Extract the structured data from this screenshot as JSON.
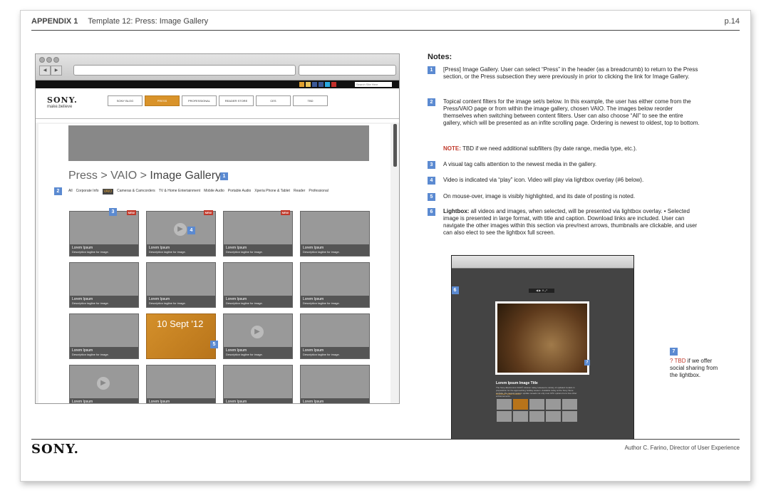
{
  "header": {
    "appendix": "APPENDIX 1",
    "template": "Template 12: Press: Image Gallery",
    "page": "p.14"
  },
  "footer": {
    "logo": "SONY.",
    "author": "Author C. Farino, Director of User Experience"
  },
  "site": {
    "logo": "SONY.",
    "tagline": "make.believe",
    "nav": [
      "SONY BLOG",
      "PRESS",
      "PROFESSIONAL",
      "READER STORE",
      "CES",
      "TBD"
    ],
    "nav_active": "PRESS",
    "search_placeholder": "Search Site Here"
  },
  "gallery": {
    "breadcrumb": {
      "p1": "Press",
      "sep1": " > ",
      "p2": "VAIO",
      "sep2": " > ",
      "p3": "Image Gallery"
    },
    "filters": [
      "All",
      "Corporate Info",
      "VAIO",
      "Cameras & Camcorders",
      "TV & Home Entertainment",
      "Mobile Audio",
      "Portable Audio",
      "Xperia Phone & Tablet",
      "Reader",
      "Professional"
    ],
    "filter_active": "VAIO",
    "tile_title": "Lorem Ipsum",
    "tile_desc": "Description tagline for image.",
    "new_badge": "NEW",
    "highlight_date": "10 Sept '12"
  },
  "annotations": {
    "n1": "1",
    "n2": "2",
    "n3": "3",
    "n4": "4",
    "n5": "5",
    "n6": "6",
    "n7": "7"
  },
  "notes": {
    "title": "Notes:",
    "items": [
      {
        "num": "1",
        "text": "[Press] Image Gallery. User can select “Press” in the header (as a breadcrumb) to return to the Press section, or the Press subsection they were previously in prior to clicking the link for Image Gallery."
      },
      {
        "num": "2",
        "text": "Topical content filters for the image set/s below. In this example, the user has either come from the Press/VAIO page or from within the image gallery, chosen VAIO. The images below reorder themselves when switching between content filters. User can also choose “All” to see the entire gallery, which will be presented as an infite scrolling page. Ordering is newest to oldest, top to bottom."
      },
      {
        "num": "",
        "label": "NOTE:",
        "text": "TBD if we need additional subfilters (by date range, media type, etc.)."
      },
      {
        "num": "3",
        "text": "A visual tag calls attention to the newest media in the gallery."
      },
      {
        "num": "4",
        "text": "Video is indicated via “play” icon. Video will play via lightbox overlay (#6 below)."
      },
      {
        "num": "5",
        "text": "On mouse-over, image is visibly highlighted, and its date of posting is noted."
      },
      {
        "num": "6",
        "label": "Lightbox:",
        "text": "all videos and images, when selected, will be presented via lightbox overlay. • Selected image is presented in large format, with title and caption. Download links are included. User can navigate the other images within this section via prev/next arrows, thumbnails are clickable, and user can also elect to see the lightbox full screen."
      }
    ]
  },
  "lightbox": {
    "title": "Lorem Ipsum Image Title",
    "desc": "The Sony Electronics VAIO® division today released a variety of updated models in preparation for the approaching holiday season. Available today at the Sony Store website, the newest season update reveals not only new CPU options but a few other enhancements.",
    "download": "Download:  HiRes  LowRes",
    "controls": "◀ ▶ ✕ ⤢"
  },
  "tbd7": {
    "q": "? TBD",
    "text": " if we offer social sharing from the lightbox."
  },
  "colors": {
    "accent": "#d9932a",
    "annotation": "#5b8ad1",
    "alert": "#c0392b"
  }
}
